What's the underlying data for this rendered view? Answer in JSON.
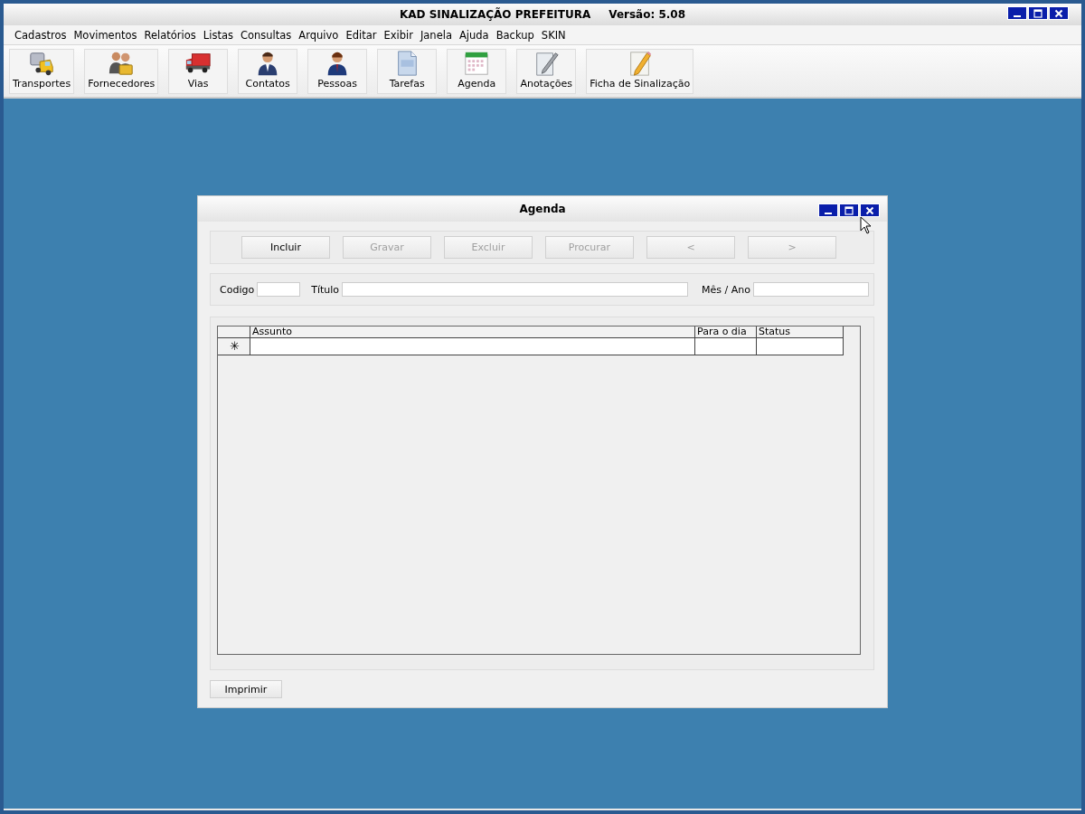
{
  "window": {
    "title": "KAD SINALIZAÇÃO PREFEITURA",
    "version": "Versão: 5.08"
  },
  "menu": [
    "Cadastros",
    "Movimentos",
    "Relatórios",
    "Listas",
    "Consultas",
    "Arquivo",
    "Editar",
    "Exibir",
    "Janela",
    "Ajuda",
    "Backup",
    "SKIN"
  ],
  "toolbar": [
    {
      "label": "Transportes",
      "kind": "truck"
    },
    {
      "label": "Fornecedores",
      "kind": "people"
    },
    {
      "label": "Vias",
      "kind": "lorry"
    },
    {
      "label": "Contatos",
      "kind": "person"
    },
    {
      "label": "Pessoas",
      "kind": "person2"
    },
    {
      "label": "Tarefas",
      "kind": "document"
    },
    {
      "label": "Agenda",
      "kind": "calendar"
    },
    {
      "label": "Anotações",
      "kind": "note"
    },
    {
      "label": "Ficha de Sinalização",
      "kind": "pencil"
    }
  ],
  "dialog": {
    "title": "Agenda",
    "buttons": [
      {
        "label": "Incluir",
        "disabled": false
      },
      {
        "label": "Gravar",
        "disabled": true
      },
      {
        "label": "Excluir",
        "disabled": true
      },
      {
        "label": "Procurar",
        "disabled": true
      },
      {
        "label": "<",
        "disabled": true
      },
      {
        "label": ">",
        "disabled": true
      }
    ],
    "fields": [
      {
        "label": "Codigo",
        "kind": "short"
      },
      {
        "label": "Título",
        "kind": "wide"
      },
      {
        "label": "Mês / Ano",
        "kind": "medium"
      }
    ],
    "table": {
      "columns": [
        "Assunto",
        "Para o dia",
        "Status"
      ],
      "new_row_marker": "✳"
    },
    "print_button": "Imprimir"
  }
}
